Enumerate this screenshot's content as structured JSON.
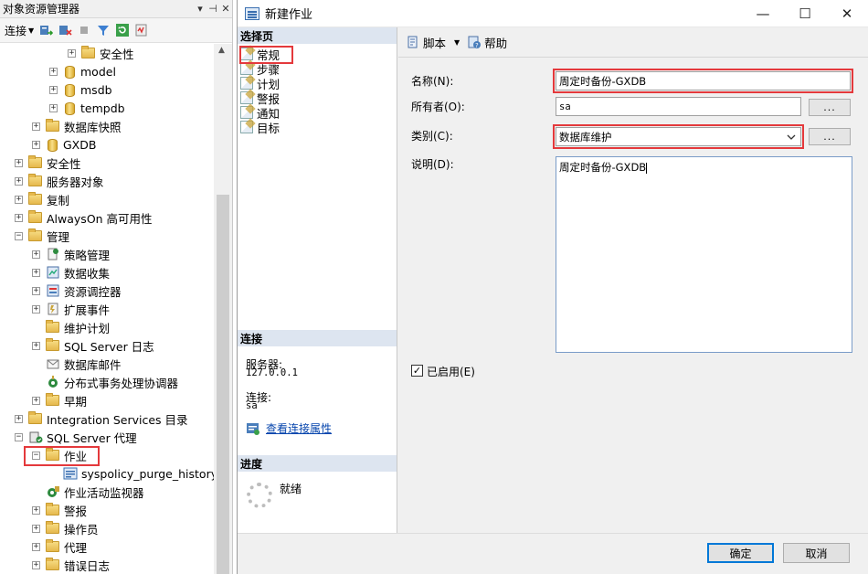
{
  "object_explorer": {
    "title": "对象资源管理器",
    "title_buttons": [
      "▾",
      "⊣",
      "✕"
    ],
    "toolbar": {
      "connect_label": "连接"
    },
    "tree": [
      {
        "id": "anquanxing-db",
        "label": "安全性",
        "icon": "folder",
        "exp": "+"
      },
      {
        "id": "model",
        "label": "model",
        "icon": "database",
        "exp": "+"
      },
      {
        "id": "msdb",
        "label": "msdb",
        "icon": "database",
        "exp": "+"
      },
      {
        "id": "tempdb",
        "label": "tempdb",
        "icon": "database",
        "exp": "+"
      },
      {
        "id": "snapshots",
        "label": "数据库快照",
        "icon": "folder",
        "exp": "+"
      },
      {
        "id": "gxdb",
        "label": "GXDB",
        "icon": "database",
        "exp": "+"
      },
      {
        "id": "security",
        "label": "安全性",
        "icon": "folder",
        "exp": "+"
      },
      {
        "id": "server-objects",
        "label": "服务器对象",
        "icon": "folder",
        "exp": "+"
      },
      {
        "id": "replication",
        "label": "复制",
        "icon": "folder",
        "exp": "+"
      },
      {
        "id": "alwayson",
        "label": "AlwaysOn 高可用性",
        "icon": "folder",
        "exp": "+"
      },
      {
        "id": "management",
        "label": "管理",
        "icon": "folder",
        "exp": "−"
      },
      {
        "id": "policy",
        "label": "策略管理",
        "icon": "policy",
        "exp": "+"
      },
      {
        "id": "data-collection",
        "label": "数据收集",
        "icon": "collection",
        "exp": "+"
      },
      {
        "id": "resource-governor",
        "label": "资源调控器",
        "icon": "governor",
        "exp": "+"
      },
      {
        "id": "xevents",
        "label": "扩展事件",
        "icon": "xevents",
        "exp": "+"
      },
      {
        "id": "maint-plans",
        "label": "维护计划",
        "icon": "folder",
        "exp": ""
      },
      {
        "id": "sql-logs",
        "label": "SQL Server 日志",
        "icon": "folder",
        "exp": "+"
      },
      {
        "id": "dbmail",
        "label": "数据库邮件",
        "icon": "mail",
        "exp": ""
      },
      {
        "id": "dtc",
        "label": "分布式事务处理协调器",
        "icon": "dtc",
        "exp": ""
      },
      {
        "id": "legacy",
        "label": "早期",
        "icon": "folder",
        "exp": "+"
      },
      {
        "id": "integration",
        "label": "Integration Services 目录",
        "icon": "folder",
        "exp": "+"
      },
      {
        "id": "agent",
        "label": "SQL Server 代理",
        "icon": "agent",
        "exp": "−"
      },
      {
        "id": "jobs",
        "label": "作业",
        "icon": "folder",
        "exp": "−"
      },
      {
        "id": "syspolicy",
        "label": "syspolicy_purge_history",
        "icon": "job",
        "exp": ""
      },
      {
        "id": "job-monitor",
        "label": "作业活动监视器",
        "icon": "monitor",
        "exp": ""
      },
      {
        "id": "alerts",
        "label": "警报",
        "icon": "folder",
        "exp": "+"
      },
      {
        "id": "operators",
        "label": "操作员",
        "icon": "folder",
        "exp": "+"
      },
      {
        "id": "proxies",
        "label": "代理",
        "icon": "folder",
        "exp": "+"
      },
      {
        "id": "errorlogs",
        "label": "错误日志",
        "icon": "folder",
        "exp": "+"
      }
    ]
  },
  "dialog": {
    "title": "新建作业",
    "window_buttons": {
      "minimize": "—",
      "maximize": "☐",
      "close": "✕"
    },
    "select_page_header": "选择页",
    "pages": [
      "常规",
      "步骤",
      "计划",
      "警报",
      "通知",
      "目标"
    ],
    "connection_header": "连接",
    "server_label": "服务器:",
    "server_value": "127.0.0.1",
    "connection_label": "连接:",
    "connection_value": "sa",
    "view_props_link": "查看连接属性",
    "progress_header": "进度",
    "progress_status": "就绪",
    "toolbar": {
      "script_label": "脚本",
      "help_label": "帮助"
    },
    "form": {
      "name_label": "名称(N):",
      "name_value": "周定时备份-GXDB",
      "owner_label": "所有者(O):",
      "owner_value": "sa",
      "category_label": "类别(C):",
      "category_value": "数据库维护",
      "description_label": "说明(D):",
      "description_value": "周定时备份-GXDB",
      "browse_label": "...",
      "enabled_label": "已启用(E)",
      "enabled": true
    },
    "ok_label": "确定",
    "cancel_label": "取消"
  }
}
